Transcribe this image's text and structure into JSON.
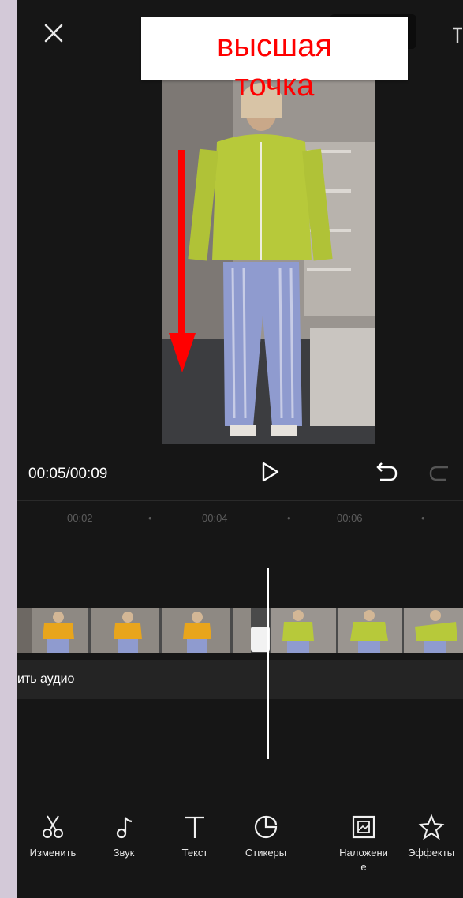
{
  "overlay": {
    "label": "высшая\nточка"
  },
  "controls": {
    "time": "00:05/00:09"
  },
  "ruler": {
    "marks": [
      "00:02",
      "00:04",
      "00:06"
    ]
  },
  "audio_track": {
    "label": "ить аудио"
  },
  "toolbar": {
    "items": [
      {
        "label": "Изменить",
        "icon": "scissors-icon"
      },
      {
        "label": "Звук",
        "icon": "music-note-icon"
      },
      {
        "label": "Текст",
        "icon": "text-icon"
      },
      {
        "label": "Стикеры",
        "icon": "sticker-icon"
      },
      {
        "label": "Наложени\nе",
        "icon": "overlay-icon"
      },
      {
        "label": "Эффекты",
        "icon": "effects-icon"
      }
    ]
  },
  "colors": {
    "accent": "#ff0000",
    "background": "#161616",
    "page": "#d3c9d8"
  }
}
